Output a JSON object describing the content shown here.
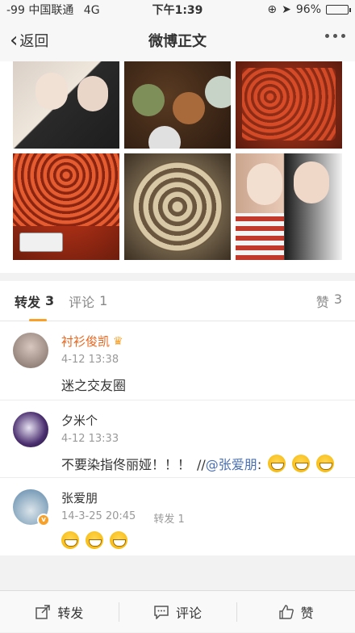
{
  "status_bar": {
    "signal": "-99",
    "carrier": "中国联通",
    "network": "4G",
    "time": "下午1:39",
    "battery_text": "96%",
    "battery_level": 0.96
  },
  "nav": {
    "back_label": "返回",
    "title": "微博正文"
  },
  "tabs": {
    "repost_label": "转发",
    "repost_count": "3",
    "comment_label": "评论",
    "comment_count": "1",
    "like_label": "赞",
    "like_count": "3"
  },
  "comments": [
    {
      "name": "衬衫俊凯",
      "time": "4-12 13:38",
      "text": "迷之交友圈"
    },
    {
      "name": "夕米个",
      "time": "4-12 13:33",
      "text": "不要染指佟丽娅！！！",
      "repost_chain": "//",
      "mention": "@张爱朋",
      "colon": ":"
    },
    {
      "name": "张爱朋",
      "time": "14-3-25 20:45",
      "reposts": "转发 1"
    }
  ],
  "bottom_bar": {
    "repost": "转发",
    "comment": "评论",
    "like": "赞"
  },
  "icons": {
    "back": "chevron-left-icon",
    "more": "more-dots-icon",
    "repost": "share-icon",
    "comment": "comment-icon",
    "like": "thumbs-up-icon"
  },
  "colors": {
    "accent": "#f7a12a",
    "mention": "#4a6fb0",
    "highlight_name": "#e8661e"
  }
}
